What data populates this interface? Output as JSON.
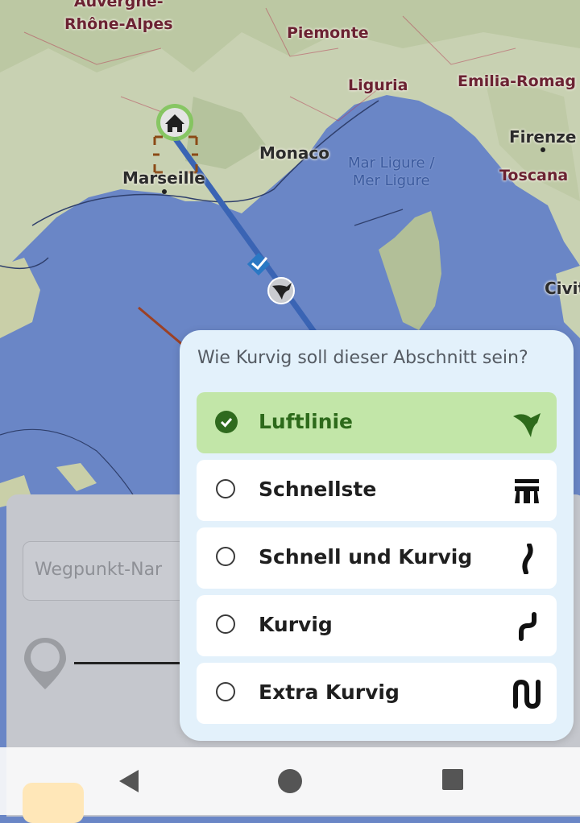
{
  "map": {
    "labels": [
      {
        "key": "auvergne",
        "text": "Auvergne-\nRhône-Alpes"
      },
      {
        "key": "piemonte",
        "text": "Piemonte"
      },
      {
        "key": "liguria",
        "text": "Liguria"
      },
      {
        "key": "emilia",
        "text": "Emilia-Romag"
      },
      {
        "key": "monaco",
        "text": "Monaco"
      },
      {
        "key": "firenze",
        "text": "Firenze"
      },
      {
        "key": "toscana",
        "text": "Toscana"
      },
      {
        "key": "marseille",
        "text": "Marseille"
      },
      {
        "key": "marligure",
        "text": "Mar Ligure /\nMer Ligure"
      },
      {
        "key": "civit",
        "text": "Civit"
      }
    ],
    "colors": {
      "sea": "#6a86c6",
      "land": "#c9d2b4",
      "route": "#3a64b4",
      "home": "#6fbd44"
    }
  },
  "sheet": {
    "waypoint_placeholder": "Wegpunkt-Nar"
  },
  "dialog": {
    "title": "Wie Kurvig soll dieser Abschnitt sein?",
    "options": [
      {
        "label": "Luftlinie",
        "icon": "bird-icon",
        "selected": true
      },
      {
        "label": "Schnellste",
        "icon": "highway-icon",
        "selected": false
      },
      {
        "label": "Schnell und Kurvig",
        "icon": "curve-mild-icon",
        "selected": false
      },
      {
        "label": "Kurvig",
        "icon": "curve-icon",
        "selected": false
      },
      {
        "label": "Extra Kurvig",
        "icon": "curve-extra-icon",
        "selected": false
      }
    ]
  },
  "navbar": {
    "buttons": [
      "back-icon",
      "home-icon",
      "recents-icon"
    ]
  }
}
